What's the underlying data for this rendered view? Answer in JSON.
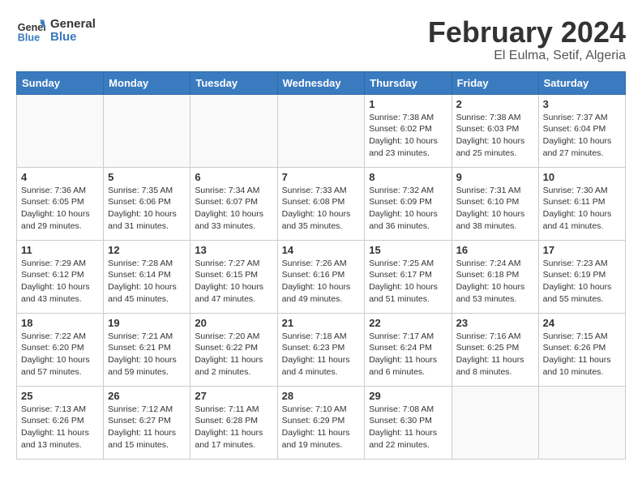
{
  "logo": {
    "line1": "General",
    "line2": "Blue"
  },
  "title": "February 2024",
  "subtitle": "El Eulma, Setif, Algeria",
  "days_header": [
    "Sunday",
    "Monday",
    "Tuesday",
    "Wednesday",
    "Thursday",
    "Friday",
    "Saturday"
  ],
  "weeks": [
    [
      {
        "day": "",
        "info": ""
      },
      {
        "day": "",
        "info": ""
      },
      {
        "day": "",
        "info": ""
      },
      {
        "day": "",
        "info": ""
      },
      {
        "day": "1",
        "info": "Sunrise: 7:38 AM\nSunset: 6:02 PM\nDaylight: 10 hours\nand 23 minutes."
      },
      {
        "day": "2",
        "info": "Sunrise: 7:38 AM\nSunset: 6:03 PM\nDaylight: 10 hours\nand 25 minutes."
      },
      {
        "day": "3",
        "info": "Sunrise: 7:37 AM\nSunset: 6:04 PM\nDaylight: 10 hours\nand 27 minutes."
      }
    ],
    [
      {
        "day": "4",
        "info": "Sunrise: 7:36 AM\nSunset: 6:05 PM\nDaylight: 10 hours\nand 29 minutes."
      },
      {
        "day": "5",
        "info": "Sunrise: 7:35 AM\nSunset: 6:06 PM\nDaylight: 10 hours\nand 31 minutes."
      },
      {
        "day": "6",
        "info": "Sunrise: 7:34 AM\nSunset: 6:07 PM\nDaylight: 10 hours\nand 33 minutes."
      },
      {
        "day": "7",
        "info": "Sunrise: 7:33 AM\nSunset: 6:08 PM\nDaylight: 10 hours\nand 35 minutes."
      },
      {
        "day": "8",
        "info": "Sunrise: 7:32 AM\nSunset: 6:09 PM\nDaylight: 10 hours\nand 36 minutes."
      },
      {
        "day": "9",
        "info": "Sunrise: 7:31 AM\nSunset: 6:10 PM\nDaylight: 10 hours\nand 38 minutes."
      },
      {
        "day": "10",
        "info": "Sunrise: 7:30 AM\nSunset: 6:11 PM\nDaylight: 10 hours\nand 41 minutes."
      }
    ],
    [
      {
        "day": "11",
        "info": "Sunrise: 7:29 AM\nSunset: 6:12 PM\nDaylight: 10 hours\nand 43 minutes."
      },
      {
        "day": "12",
        "info": "Sunrise: 7:28 AM\nSunset: 6:14 PM\nDaylight: 10 hours\nand 45 minutes."
      },
      {
        "day": "13",
        "info": "Sunrise: 7:27 AM\nSunset: 6:15 PM\nDaylight: 10 hours\nand 47 minutes."
      },
      {
        "day": "14",
        "info": "Sunrise: 7:26 AM\nSunset: 6:16 PM\nDaylight: 10 hours\nand 49 minutes."
      },
      {
        "day": "15",
        "info": "Sunrise: 7:25 AM\nSunset: 6:17 PM\nDaylight: 10 hours\nand 51 minutes."
      },
      {
        "day": "16",
        "info": "Sunrise: 7:24 AM\nSunset: 6:18 PM\nDaylight: 10 hours\nand 53 minutes."
      },
      {
        "day": "17",
        "info": "Sunrise: 7:23 AM\nSunset: 6:19 PM\nDaylight: 10 hours\nand 55 minutes."
      }
    ],
    [
      {
        "day": "18",
        "info": "Sunrise: 7:22 AM\nSunset: 6:20 PM\nDaylight: 10 hours\nand 57 minutes."
      },
      {
        "day": "19",
        "info": "Sunrise: 7:21 AM\nSunset: 6:21 PM\nDaylight: 10 hours\nand 59 minutes."
      },
      {
        "day": "20",
        "info": "Sunrise: 7:20 AM\nSunset: 6:22 PM\nDaylight: 11 hours\nand 2 minutes."
      },
      {
        "day": "21",
        "info": "Sunrise: 7:18 AM\nSunset: 6:23 PM\nDaylight: 11 hours\nand 4 minutes."
      },
      {
        "day": "22",
        "info": "Sunrise: 7:17 AM\nSunset: 6:24 PM\nDaylight: 11 hours\nand 6 minutes."
      },
      {
        "day": "23",
        "info": "Sunrise: 7:16 AM\nSunset: 6:25 PM\nDaylight: 11 hours\nand 8 minutes."
      },
      {
        "day": "24",
        "info": "Sunrise: 7:15 AM\nSunset: 6:26 PM\nDaylight: 11 hours\nand 10 minutes."
      }
    ],
    [
      {
        "day": "25",
        "info": "Sunrise: 7:13 AM\nSunset: 6:26 PM\nDaylight: 11 hours\nand 13 minutes."
      },
      {
        "day": "26",
        "info": "Sunrise: 7:12 AM\nSunset: 6:27 PM\nDaylight: 11 hours\nand 15 minutes."
      },
      {
        "day": "27",
        "info": "Sunrise: 7:11 AM\nSunset: 6:28 PM\nDaylight: 11 hours\nand 17 minutes."
      },
      {
        "day": "28",
        "info": "Sunrise: 7:10 AM\nSunset: 6:29 PM\nDaylight: 11 hours\nand 19 minutes."
      },
      {
        "day": "29",
        "info": "Sunrise: 7:08 AM\nSunset: 6:30 PM\nDaylight: 11 hours\nand 22 minutes."
      },
      {
        "day": "",
        "info": ""
      },
      {
        "day": "",
        "info": ""
      }
    ]
  ]
}
